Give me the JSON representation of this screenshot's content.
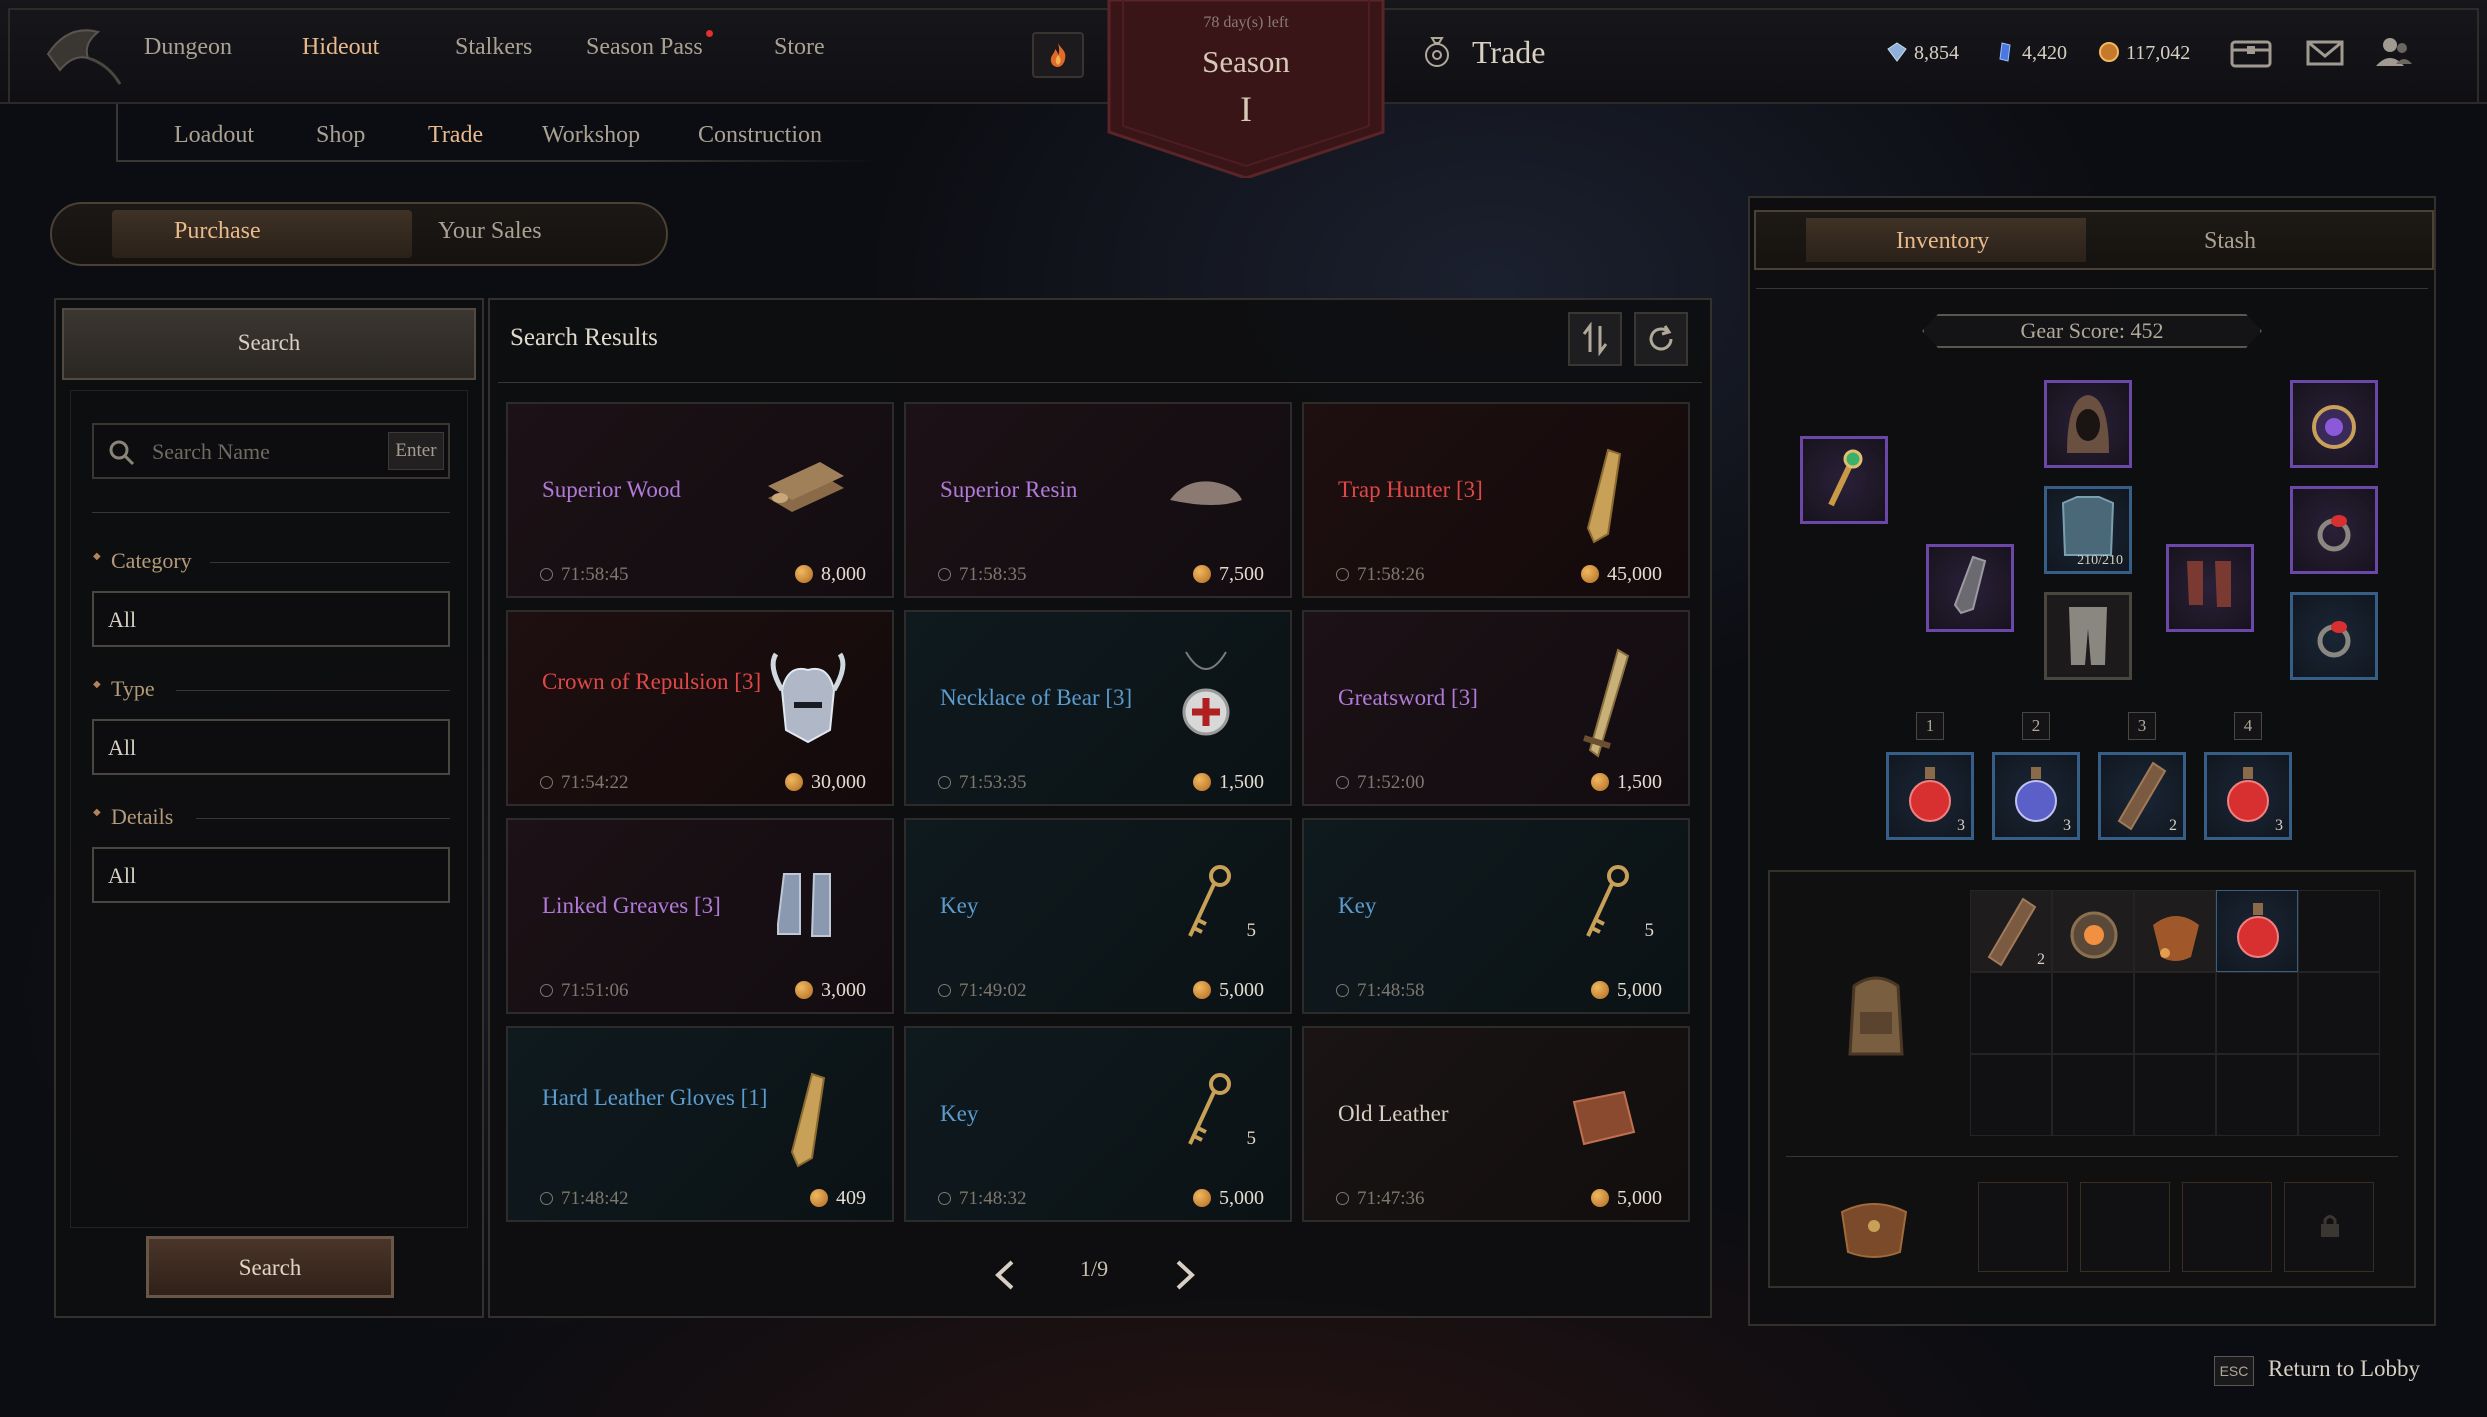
{
  "nav": {
    "items": [
      "Dungeon",
      "Hideout",
      "Stalkers",
      "Season Pass",
      "Store"
    ],
    "active": "Hideout"
  },
  "season": {
    "days_left": "78 day(s) left",
    "title": "Season",
    "number": "I"
  },
  "trade_title": "Trade",
  "currencies": {
    "shards": "8,854",
    "gems": "4,420",
    "gold": "117,042"
  },
  "subnav": {
    "items": [
      "Loadout",
      "Shop",
      "Trade",
      "Workshop",
      "Construction"
    ],
    "active": "Trade"
  },
  "purchase_tabs": {
    "purchase": "Purchase",
    "your_sales": "Your Sales"
  },
  "filter": {
    "tab": "Search",
    "search_placeholder": "Search Name",
    "enter_label": "Enter",
    "category_label": "Category",
    "category_value": "All",
    "type_label": "Type",
    "type_value": "All",
    "details_label": "Details",
    "details_value": "All",
    "search_button": "Search"
  },
  "results": {
    "title": "Search Results",
    "items": [
      {
        "name": "Superior Wood",
        "rarity": "epic",
        "time": "71:58:45",
        "price": "8,000",
        "qty": "",
        "icon": "wood-icon"
      },
      {
        "name": "Superior Resin",
        "rarity": "epic",
        "time": "71:58:35",
        "price": "7,500",
        "qty": "",
        "icon": "resin-icon"
      },
      {
        "name": "Trap Hunter [3]",
        "rarity": "legend",
        "time": "71:58:26",
        "price": "45,000",
        "qty": "",
        "icon": "glove-icon"
      },
      {
        "name": "Crown of Repulsion [3]",
        "rarity": "legend",
        "time": "71:54:22",
        "price": "30,000",
        "qty": "",
        "icon": "helmet-icon"
      },
      {
        "name": "Necklace of Bear [3]",
        "rarity": "rare",
        "time": "71:53:35",
        "price": "1,500",
        "qty": "",
        "icon": "necklace-icon"
      },
      {
        "name": "Greatsword [3]",
        "rarity": "epic",
        "time": "71:52:00",
        "price": "1,500",
        "qty": "",
        "icon": "sword-icon"
      },
      {
        "name": "Linked Greaves [3]",
        "rarity": "epic",
        "time": "71:51:06",
        "price": "3,000",
        "qty": "",
        "icon": "greaves-icon"
      },
      {
        "name": "Key",
        "rarity": "rare",
        "time": "71:49:02",
        "price": "5,000",
        "qty": "5",
        "icon": "key-icon"
      },
      {
        "name": "Key",
        "rarity": "rare",
        "time": "71:48:58",
        "price": "5,000",
        "qty": "5",
        "icon": "key-icon"
      },
      {
        "name": "Hard Leather Gloves [1]",
        "rarity": "rare",
        "time": "71:48:42",
        "price": "409",
        "qty": "",
        "icon": "glove-icon"
      },
      {
        "name": "Key",
        "rarity": "rare",
        "time": "71:48:32",
        "price": "5,000",
        "qty": "5",
        "icon": "key-icon"
      },
      {
        "name": "Old Leather",
        "rarity": "common",
        "time": "71:47:36",
        "price": "5,000",
        "qty": "",
        "icon": "leather-icon"
      }
    ],
    "page": "1/9"
  },
  "inventory": {
    "tabs": {
      "inventory": "Inventory",
      "stash": "Stash"
    },
    "gear_score": "Gear Score: 452",
    "armor_durability": "210/210",
    "quick_slots": [
      {
        "num": "1",
        "qty": "3",
        "icon": "health-potion-icon"
      },
      {
        "num": "2",
        "qty": "3",
        "icon": "mana-potion-icon"
      },
      {
        "num": "3",
        "qty": "2",
        "icon": "bandage-icon"
      },
      {
        "num": "4",
        "qty": "3",
        "icon": "health-potion-icon"
      }
    ],
    "bag_items": [
      {
        "qty": "2",
        "icon": "bandage-icon"
      },
      {
        "qty": "",
        "icon": "lantern-icon"
      },
      {
        "qty": "",
        "icon": "pouch-icon"
      },
      {
        "qty": "",
        "icon": "health-potion-icon"
      }
    ]
  },
  "footer": {
    "esc": "ESC",
    "return_label": "Return to Lobby"
  }
}
